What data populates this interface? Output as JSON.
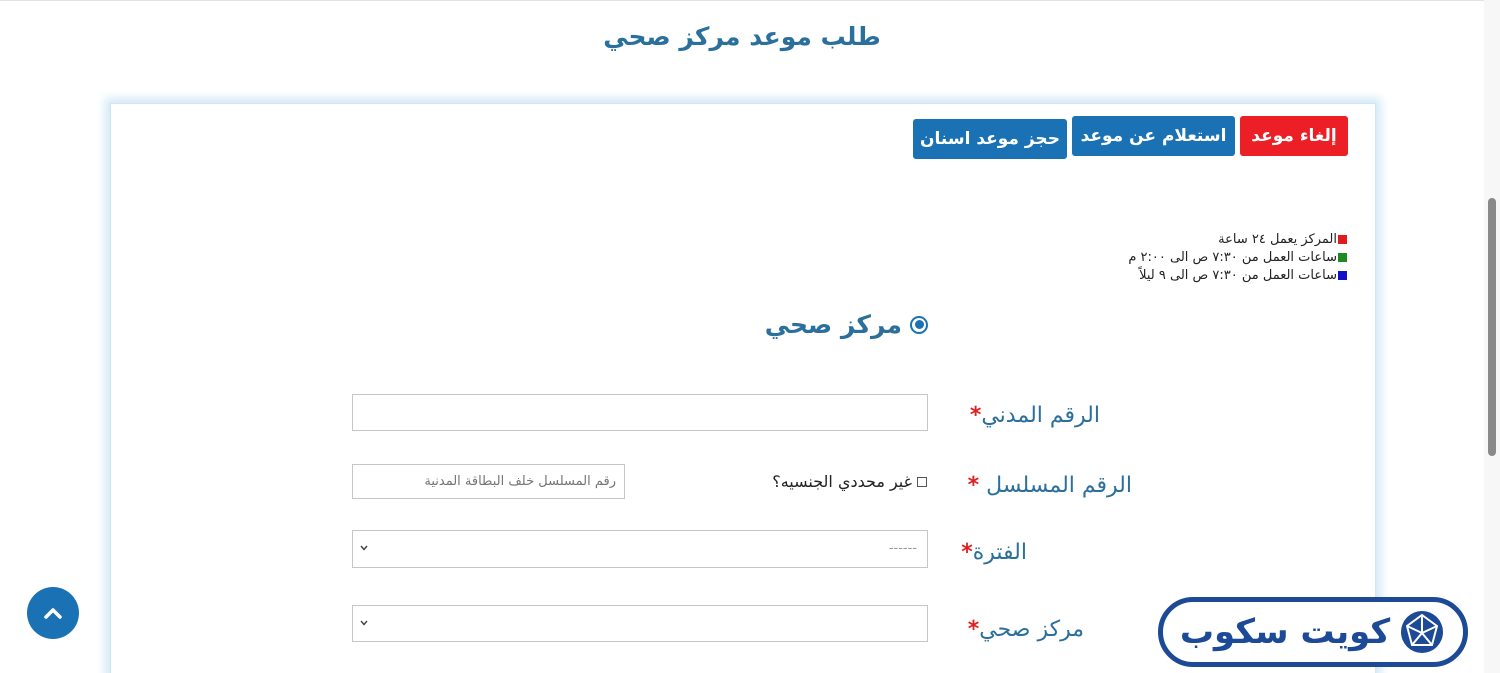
{
  "page": {
    "title": "طلب موعد مركز صحي"
  },
  "actions": {
    "cancel": "إلغاء موعد",
    "inquiry": "استعلام عن موعد",
    "dental": "حجز موعد اسنان"
  },
  "legend": [
    {
      "text": "المركز يعمل ٢٤ ساعة",
      "color": "#e01b1b"
    },
    {
      "text": "ساعات العمل من ٧:٣٠ ص الى ٢:٠٠ م",
      "color": "#1f8a1f"
    },
    {
      "text": "ساعات العمل من ٧:٣٠ ص الى ٩ ليلاً",
      "color": "#1010c8"
    }
  ],
  "type_radio": {
    "label": "مركز صحي",
    "selected": true
  },
  "form": {
    "civil_id": {
      "label": "الرقم المدني",
      "value": ""
    },
    "serial": {
      "label": "الرقم المسلسل",
      "placeholder": "رقم المسلسل خلف البطاقة المدنية"
    },
    "stateless": {
      "label": "غير محددي الجنسيه؟",
      "checked": false
    },
    "period": {
      "label": "الفترة",
      "value": "------"
    },
    "center": {
      "label": "مركز صحي",
      "value": ""
    },
    "required_mark": "*"
  },
  "watermark": {
    "text": "كويت سكوب"
  },
  "colors": {
    "accent": "#1a72b5",
    "title": "#2b6f9c",
    "danger": "#eb1f25",
    "brand": "#1c4a96"
  }
}
